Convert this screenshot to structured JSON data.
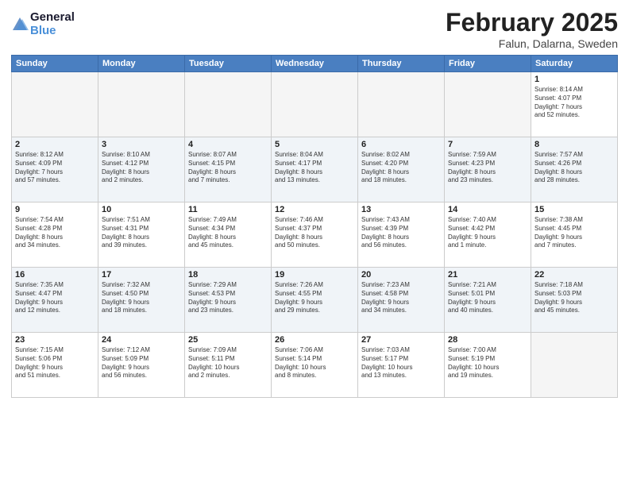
{
  "header": {
    "logo_line1": "General",
    "logo_line2": "Blue",
    "month": "February 2025",
    "location": "Falun, Dalarna, Sweden"
  },
  "weekdays": [
    "Sunday",
    "Monday",
    "Tuesday",
    "Wednesday",
    "Thursday",
    "Friday",
    "Saturday"
  ],
  "weeks": [
    [
      {
        "day": "",
        "info": ""
      },
      {
        "day": "",
        "info": ""
      },
      {
        "day": "",
        "info": ""
      },
      {
        "day": "",
        "info": ""
      },
      {
        "day": "",
        "info": ""
      },
      {
        "day": "",
        "info": ""
      },
      {
        "day": "1",
        "info": "Sunrise: 8:14 AM\nSunset: 4:07 PM\nDaylight: 7 hours\nand 52 minutes."
      }
    ],
    [
      {
        "day": "2",
        "info": "Sunrise: 8:12 AM\nSunset: 4:09 PM\nDaylight: 7 hours\nand 57 minutes."
      },
      {
        "day": "3",
        "info": "Sunrise: 8:10 AM\nSunset: 4:12 PM\nDaylight: 8 hours\nand 2 minutes."
      },
      {
        "day": "4",
        "info": "Sunrise: 8:07 AM\nSunset: 4:15 PM\nDaylight: 8 hours\nand 7 minutes."
      },
      {
        "day": "5",
        "info": "Sunrise: 8:04 AM\nSunset: 4:17 PM\nDaylight: 8 hours\nand 13 minutes."
      },
      {
        "day": "6",
        "info": "Sunrise: 8:02 AM\nSunset: 4:20 PM\nDaylight: 8 hours\nand 18 minutes."
      },
      {
        "day": "7",
        "info": "Sunrise: 7:59 AM\nSunset: 4:23 PM\nDaylight: 8 hours\nand 23 minutes."
      },
      {
        "day": "8",
        "info": "Sunrise: 7:57 AM\nSunset: 4:26 PM\nDaylight: 8 hours\nand 28 minutes."
      }
    ],
    [
      {
        "day": "9",
        "info": "Sunrise: 7:54 AM\nSunset: 4:28 PM\nDaylight: 8 hours\nand 34 minutes."
      },
      {
        "day": "10",
        "info": "Sunrise: 7:51 AM\nSunset: 4:31 PM\nDaylight: 8 hours\nand 39 minutes."
      },
      {
        "day": "11",
        "info": "Sunrise: 7:49 AM\nSunset: 4:34 PM\nDaylight: 8 hours\nand 45 minutes."
      },
      {
        "day": "12",
        "info": "Sunrise: 7:46 AM\nSunset: 4:37 PM\nDaylight: 8 hours\nand 50 minutes."
      },
      {
        "day": "13",
        "info": "Sunrise: 7:43 AM\nSunset: 4:39 PM\nDaylight: 8 hours\nand 56 minutes."
      },
      {
        "day": "14",
        "info": "Sunrise: 7:40 AM\nSunset: 4:42 PM\nDaylight: 9 hours\nand 1 minute."
      },
      {
        "day": "15",
        "info": "Sunrise: 7:38 AM\nSunset: 4:45 PM\nDaylight: 9 hours\nand 7 minutes."
      }
    ],
    [
      {
        "day": "16",
        "info": "Sunrise: 7:35 AM\nSunset: 4:47 PM\nDaylight: 9 hours\nand 12 minutes."
      },
      {
        "day": "17",
        "info": "Sunrise: 7:32 AM\nSunset: 4:50 PM\nDaylight: 9 hours\nand 18 minutes."
      },
      {
        "day": "18",
        "info": "Sunrise: 7:29 AM\nSunset: 4:53 PM\nDaylight: 9 hours\nand 23 minutes."
      },
      {
        "day": "19",
        "info": "Sunrise: 7:26 AM\nSunset: 4:55 PM\nDaylight: 9 hours\nand 29 minutes."
      },
      {
        "day": "20",
        "info": "Sunrise: 7:23 AM\nSunset: 4:58 PM\nDaylight: 9 hours\nand 34 minutes."
      },
      {
        "day": "21",
        "info": "Sunrise: 7:21 AM\nSunset: 5:01 PM\nDaylight: 9 hours\nand 40 minutes."
      },
      {
        "day": "22",
        "info": "Sunrise: 7:18 AM\nSunset: 5:03 PM\nDaylight: 9 hours\nand 45 minutes."
      }
    ],
    [
      {
        "day": "23",
        "info": "Sunrise: 7:15 AM\nSunset: 5:06 PM\nDaylight: 9 hours\nand 51 minutes."
      },
      {
        "day": "24",
        "info": "Sunrise: 7:12 AM\nSunset: 5:09 PM\nDaylight: 9 hours\nand 56 minutes."
      },
      {
        "day": "25",
        "info": "Sunrise: 7:09 AM\nSunset: 5:11 PM\nDaylight: 10 hours\nand 2 minutes."
      },
      {
        "day": "26",
        "info": "Sunrise: 7:06 AM\nSunset: 5:14 PM\nDaylight: 10 hours\nand 8 minutes."
      },
      {
        "day": "27",
        "info": "Sunrise: 7:03 AM\nSunset: 5:17 PM\nDaylight: 10 hours\nand 13 minutes."
      },
      {
        "day": "28",
        "info": "Sunrise: 7:00 AM\nSunset: 5:19 PM\nDaylight: 10 hours\nand 19 minutes."
      },
      {
        "day": "",
        "info": ""
      }
    ]
  ]
}
